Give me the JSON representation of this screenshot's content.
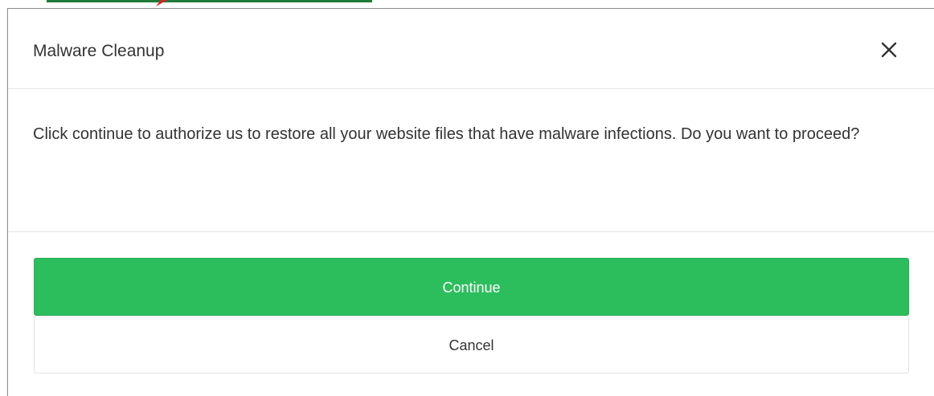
{
  "dialog": {
    "title": "Malware Cleanup",
    "close_icon": "close-icon",
    "message": "Click continue to authorize us to restore all your website files that have malware infections. Do you want to proceed?",
    "continue_label": "Continue",
    "cancel_label": "Cancel"
  },
  "colors": {
    "continue_button": "#2cbe5d",
    "text": "#333333",
    "divider": "#e5e5e5"
  }
}
